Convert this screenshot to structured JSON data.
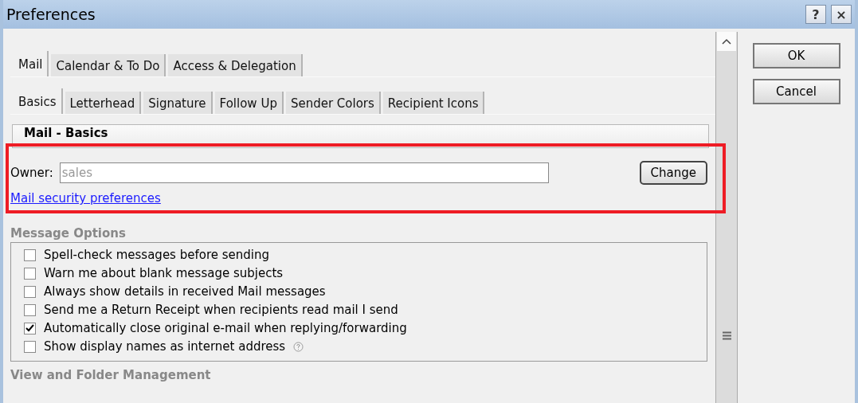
{
  "window": {
    "title": "Preferences",
    "help": "?",
    "close": "×"
  },
  "main_tabs": [
    {
      "label": "Mail",
      "selected": true
    },
    {
      "label": "Calendar & To Do",
      "selected": false
    },
    {
      "label": "Access & Delegation",
      "selected": false
    }
  ],
  "sub_tabs": [
    {
      "label": "Basics",
      "selected": true
    },
    {
      "label": "Letterhead",
      "selected": false
    },
    {
      "label": "Signature",
      "selected": false
    },
    {
      "label": "Follow Up",
      "selected": false
    },
    {
      "label": "Sender Colors",
      "selected": false
    },
    {
      "label": "Recipient Icons",
      "selected": false
    }
  ],
  "section_title": "Mail - Basics",
  "owner": {
    "label": "Owner:",
    "value": "sales",
    "button": "Change"
  },
  "security_link": "Mail security preferences",
  "message_options": {
    "title": "Message Options",
    "items": [
      {
        "label": "Spell-check messages before sending",
        "checked": false,
        "help": false
      },
      {
        "label": "Warn me about blank message subjects",
        "checked": false,
        "help": false
      },
      {
        "label": "Always show details in received Mail messages",
        "checked": false,
        "help": false
      },
      {
        "label": "Send me a Return Receipt when recipients read mail I send",
        "checked": false,
        "help": false
      },
      {
        "label": "Automatically close original e-mail when replying/forwarding",
        "checked": true,
        "help": false
      },
      {
        "label": "Show display names as internet address",
        "checked": false,
        "help": true
      }
    ]
  },
  "next_section": "View and Folder Management",
  "buttons": [
    "OK",
    "Cancel"
  ]
}
